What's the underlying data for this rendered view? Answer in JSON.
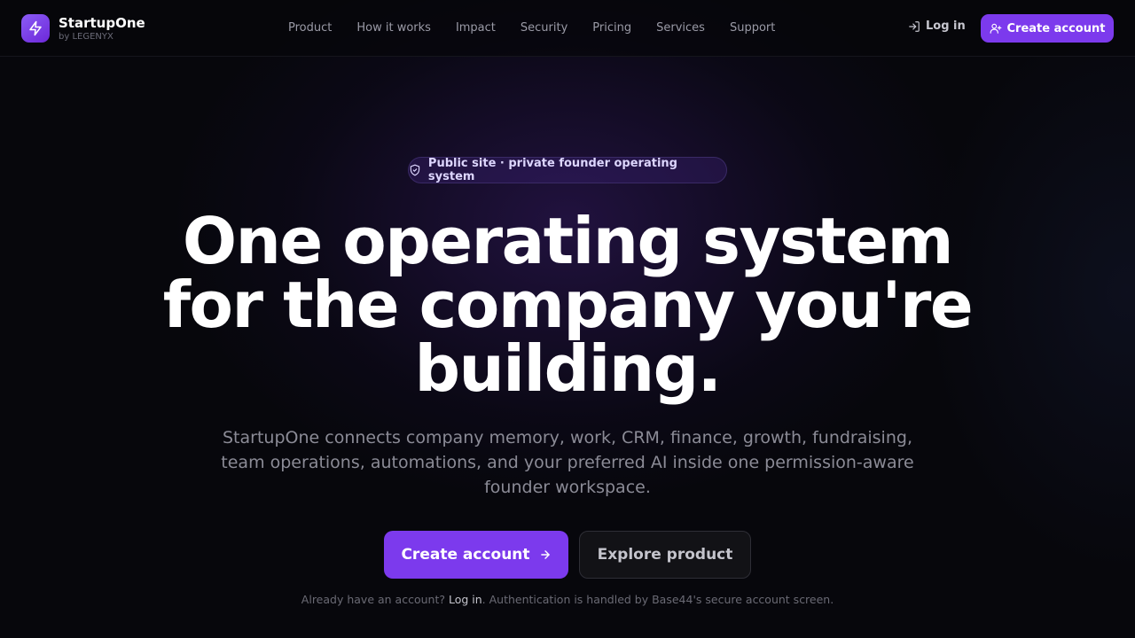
{
  "brand": {
    "name": "StartupOne",
    "byline": "by LEGENYX",
    "icon": "lightning-bolt-icon",
    "accent_color": "#7c3aed"
  },
  "nav": {
    "items": [
      {
        "label": "Product"
      },
      {
        "label": "How it works"
      },
      {
        "label": "Impact"
      },
      {
        "label": "Security"
      },
      {
        "label": "Pricing"
      },
      {
        "label": "Services"
      },
      {
        "label": "Support"
      }
    ],
    "login_label": "Log in",
    "login_icon": "log-in-icon",
    "create_account_label": "Create account",
    "create_account_icon": "user-plus-icon"
  },
  "hero": {
    "badge_text": "Public site · private founder operating system",
    "badge_icon": "shield-check-icon",
    "headline": "One operating system for the company you're building.",
    "subtext": "StartupOne connects company memory, work, CRM, finance, growth, fundraising, team operations, automations, and your preferred AI inside one permission-aware founder workspace.",
    "primary_cta_label": "Create account",
    "primary_cta_icon": "arrow-right-icon",
    "secondary_cta_label": "Explore product",
    "footnote": {
      "prefix": "Already have an account? ",
      "login_link": "Log in",
      "suffix": ". Authentication is handled by Base44's secure account screen."
    }
  }
}
